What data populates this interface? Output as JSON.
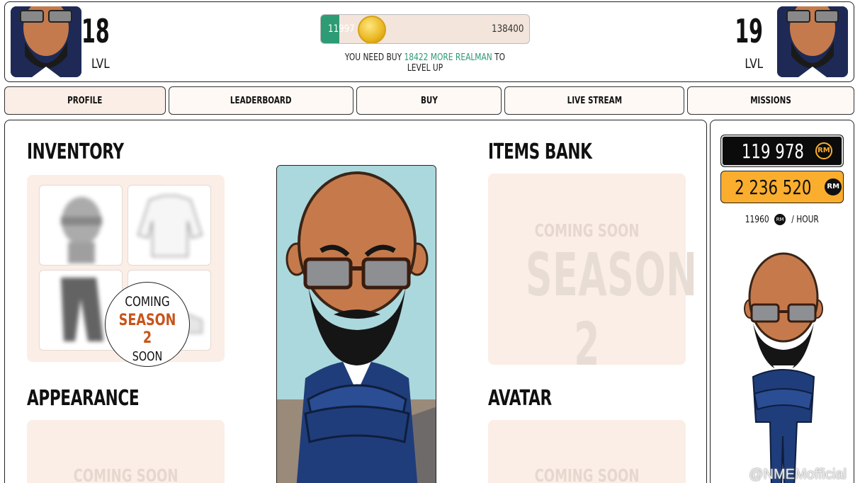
{
  "header": {
    "current_level": "18",
    "next_level": "19",
    "level_label": "LVL",
    "progress_current": "11997",
    "progress_max": "138400",
    "progress_fraction": 0.087,
    "levelup_prefix": "YOU NEED BUY",
    "levelup_amount": "18422 MORE REALMAN",
    "levelup_suffix": "TO LEVEL UP"
  },
  "nav": {
    "tabs": [
      {
        "label": "PROFILE"
      },
      {
        "label": "LEADERBOARD"
      },
      {
        "label": "BUY"
      },
      {
        "label": "LIVE STREAM"
      },
      {
        "label": "MISSIONS"
      }
    ]
  },
  "inventory": {
    "title": "INVENTORY",
    "badge_line1": "COMING",
    "badge_line2": "SEASON 2",
    "badge_line3": "SOON"
  },
  "items_bank": {
    "title": "ITEMS BANK",
    "coming_soon": "COMING SOON",
    "season": "SEASON 2"
  },
  "appearance": {
    "title": "APPEARANCE",
    "coming_soon": "COMING SOON"
  },
  "avatar_section": {
    "title": "AVATAR",
    "coming_soon": "COMING SOON"
  },
  "side": {
    "balance_black": "119 978",
    "balance_orange": "2 236 520",
    "rate_value": "11960",
    "rate_unit": "/ HOUR",
    "token_icon": "rm-token-icon"
  },
  "watermark": "@NMEMofficial",
  "colors": {
    "accent_green": "#2d9b73",
    "accent_orange": "#fbae2d",
    "season_red": "#c8541b",
    "panel": "#fbeee6"
  }
}
